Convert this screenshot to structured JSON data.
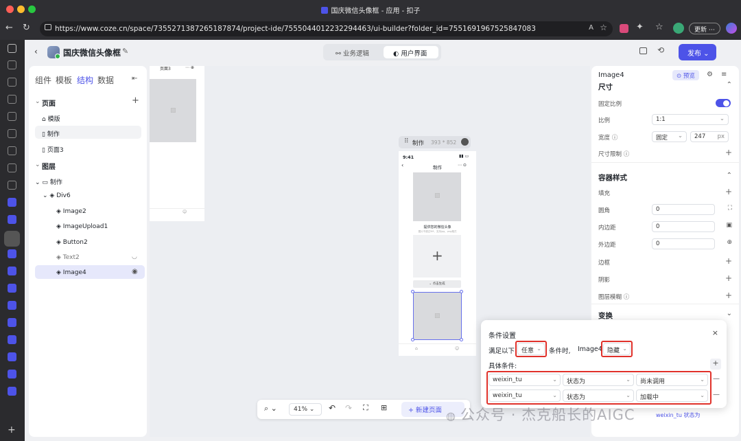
{
  "window": {
    "title": "国庆微信头像框 - 应用 - 扣子"
  },
  "browser": {
    "url": "https://www.coze.cn/space/7355271387265187874/project-ide/7555044012232294463/ui-builder?folder_id=7551691967525847083",
    "update_label": "更新",
    "aa_label": "Aᴬ"
  },
  "header": {
    "project_title": "国庆微信头像框",
    "tab_logic": "业务逻辑",
    "tab_ui": "用户界面",
    "publish_label": "发布"
  },
  "left_panel": {
    "tabs": [
      "组件",
      "模板",
      "结构",
      "数据"
    ],
    "pages_section": "页面",
    "pages": [
      "模版",
      "制作",
      "页面3"
    ],
    "layers_section": "图层",
    "layers": [
      {
        "label": "制作",
        "level": 0
      },
      {
        "label": "Div6",
        "level": 1
      },
      {
        "label": "Image2",
        "level": 2
      },
      {
        "label": "ImageUpload1",
        "level": 2
      },
      {
        "label": "Button2",
        "level": 2
      },
      {
        "label": "Text2",
        "level": 2
      },
      {
        "label": "Image4",
        "level": 2
      }
    ]
  },
  "canvas": {
    "page3_label": "页面3",
    "frame_label": "制作",
    "frame_size": "393 * 852",
    "time": "9:41",
    "page_title": "制作",
    "upload_title": "提供您的微信头像",
    "upload_hint": "图片不超过5M，支持jpg、png格式",
    "button_label": "点击生成",
    "zoom": "41%",
    "new_page_label": "新建页面"
  },
  "right_panel": {
    "component_name": "Image4",
    "preview_label": "预览",
    "size_section": "尺寸",
    "fixed_ratio_label": "固定比例",
    "ratio_label": "比例",
    "ratio_value": "1:1",
    "width_label": "宽度",
    "width_mode": "固定",
    "width_value": "247",
    "width_unit": "px",
    "size_limit_label": "尺寸限制",
    "container_section": "容器样式",
    "fill_label": "填充",
    "radius_label": "圆角",
    "radius_value": "0",
    "padding_label": "内边距",
    "padding_value": "0",
    "margin_label": "外边距",
    "margin_value": "0",
    "border_label": "边框",
    "shadow_label": "阴影",
    "blur_label": "图层模糊",
    "transform_section": "变换",
    "condition_preview": "weixin_tu 状态为"
  },
  "condition_dialog": {
    "title": "条件设置",
    "prefix": "满足以下",
    "match_mode": "任意",
    "middle": "条件时,",
    "target": "Image4",
    "action": "隐藏",
    "specific_label": "具体条件:",
    "rows": [
      {
        "variable": "weixin_tu",
        "operator": "状态为",
        "value": "尚未调用"
      },
      {
        "variable": "weixin_tu",
        "operator": "状态为",
        "value": "加载中"
      }
    ]
  },
  "watermark": "公众号 · 杰克船长的AIGC",
  "colors": {
    "accent": "#4d53e8",
    "red_highlight": "#e0312a",
    "toggle": "#4d53e8"
  }
}
